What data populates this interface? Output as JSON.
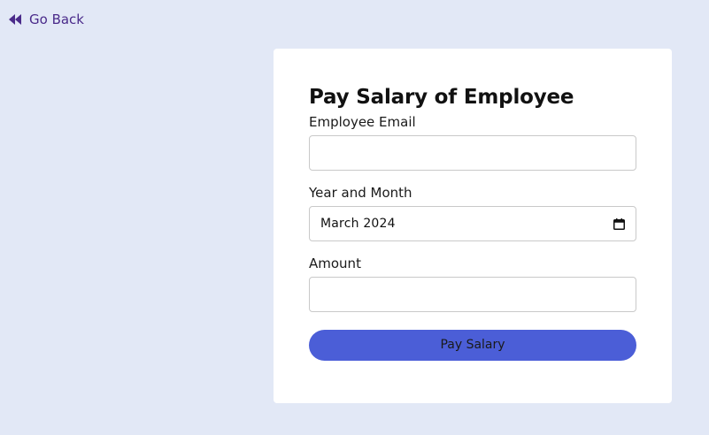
{
  "nav": {
    "back_label": "Go Back",
    "back_icon": "double-chevron-left-icon",
    "back_color": "#4a2a8a"
  },
  "form": {
    "title": "Pay Salary of Employee",
    "email_label": "Employee Email",
    "email_value": "",
    "month_label": "Year and Month",
    "month_value": "March 2024",
    "month_icon": "calendar-icon",
    "amount_label": "Amount",
    "amount_value": "",
    "submit_label": "Pay Salary"
  },
  "colors": {
    "page_background": "#e2e8f6",
    "card_background": "#ffffff",
    "button_background": "#4b5ed7"
  }
}
